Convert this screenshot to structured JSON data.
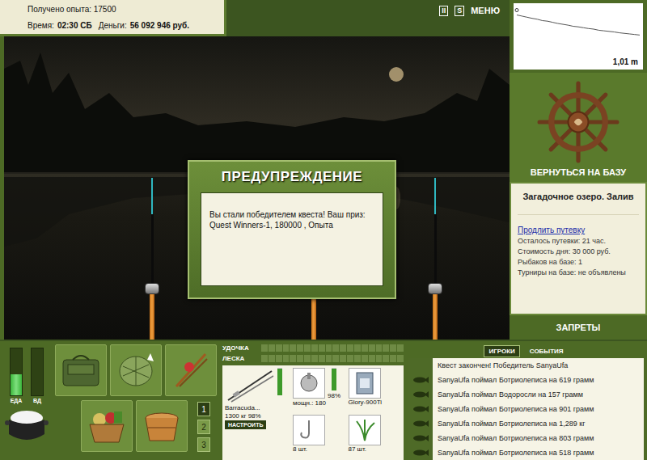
{
  "stats": {
    "experience": "Получено опыта: 17500",
    "time_label": "Время:",
    "time": "02:30 СБ",
    "money_label": "Деньги:",
    "money": "56 092 946 руб."
  },
  "toolbar": {
    "buttons": [
      "II",
      "S",
      "МЕНЮ"
    ]
  },
  "depth_chart": {
    "reading": "1,01 m",
    "values": [
      0.3,
      0.34,
      0.38,
      0.42,
      0.45,
      0.5,
      0.52,
      0.56,
      0.6,
      0.63,
      0.66,
      0.7,
      0.72,
      0.75,
      0.78,
      0.8,
      0.84,
      0.86,
      0.88,
      0.9,
      0.93,
      0.95,
      0.97,
      0.99,
      1.01
    ]
  },
  "return_button": "ВЕРНУТЬСЯ НА БАЗУ",
  "location": {
    "title": "Загадочное озеро. Залив",
    "link": "Продлить путевку",
    "lines": [
      "Осталось путевки: 21 час.",
      "Стоимость дня: 30 000 руб.",
      "Рыбаков на базе: 1",
      "Турниры на базе: не объявлены"
    ]
  },
  "bans_button": "ЗАПРЕТЫ",
  "dialog": {
    "title": "ПРЕДУПРЕЖДЕНИЕ",
    "message": "Вы стали победителем квеста! Ваш приз: Quest Winners-1, 180000 , Опыта"
  },
  "meters": [
    {
      "label": "ЕДА",
      "level": 0.45
    },
    {
      "label": "ВД",
      "level": 0
    }
  ],
  "slots": [
    {
      "label": "1",
      "selected": true
    },
    {
      "label": "2",
      "selected": false
    },
    {
      "label": "3",
      "selected": false
    }
  ],
  "tension": [
    {
      "label": "УДОЧКА",
      "level": 0
    },
    {
      "label": "ЛЕСКА",
      "level": 0
    }
  ],
  "tackle": {
    "rod": {
      "name": "Barracuda...",
      "capacity": "1300 кг",
      "reading": "98%",
      "level": 0.98,
      "button": "НАСТРОИТЬ"
    },
    "items": [
      {
        "kind": "reel",
        "caption": "мощн.: 180",
        "reading": "98%",
        "level": 0.98
      },
      {
        "kind": "line",
        "caption": "Glory-900Ti"
      },
      {
        "kind": "hook",
        "caption": "8 шт."
      },
      {
        "kind": "bait",
        "caption": "87 шт."
      }
    ]
  },
  "feed": {
    "tabs": [
      {
        "label": "ИГРОКИ",
        "selected": true
      },
      {
        "label": "СОБЫТИЯ",
        "selected": false
      }
    ],
    "entries": [
      {
        "kind": "notice",
        "text": "Квест закончен! Победитель SanyaUfa"
      },
      {
        "kind": "catch",
        "text": "SanyaUfa поймал Ботриолеписа на 619 грамм"
      },
      {
        "kind": "catch",
        "text": "SanyaUfa поймал Водоросли на 157 грамм"
      },
      {
        "kind": "catch",
        "text": "SanyaUfa поймал Ботриолеписа на 901 грамм"
      },
      {
        "kind": "catch",
        "text": "SanyaUfa поймал Ботриолеписа на 1,289 кг"
      },
      {
        "kind": "catch",
        "text": "SanyaUfa поймал Ботриолеписа на 803 грамм"
      },
      {
        "kind": "catch",
        "text": "SanyaUfa поймал Ботриолеписа на 518 грамм"
      }
    ]
  }
}
